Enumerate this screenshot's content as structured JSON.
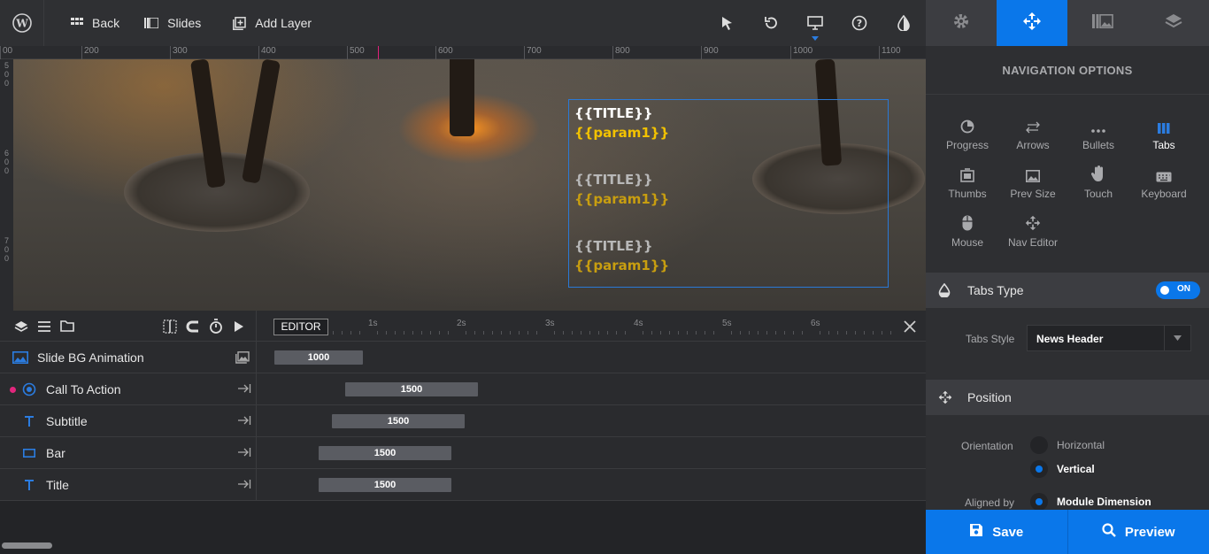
{
  "topbar": {
    "back": "Back",
    "slides": "Slides",
    "add_layer": "Add Layer"
  },
  "ruler": {
    "ticks": [
      "00",
      "200",
      "300",
      "400",
      "500",
      "600",
      "700",
      "800",
      "900",
      "1000",
      "1100"
    ],
    "vticks": [
      "500",
      "600",
      "700"
    ]
  },
  "canvas": {
    "items": [
      {
        "title": "{{TITLE}}",
        "param": "{{param1}}"
      },
      {
        "title": "{{TITLE}}",
        "param": "{{param1}}"
      },
      {
        "title": "{{TITLE}}",
        "param": "{{param1}}"
      }
    ]
  },
  "timeline": {
    "editor": "EDITOR",
    "seconds": [
      "1s",
      "2s",
      "3s",
      "4s",
      "5s",
      "6s"
    ],
    "rows": [
      {
        "label": "Slide BG Animation",
        "duration": "1000"
      },
      {
        "label": "Call To Action",
        "duration": "1500"
      },
      {
        "label": "Subtitle",
        "duration": "1500"
      },
      {
        "label": "Bar",
        "duration": "1500"
      },
      {
        "label": "Title",
        "duration": "1500"
      }
    ]
  },
  "panel": {
    "title": "NAVIGATION OPTIONS",
    "options": [
      "Progress",
      "Arrows",
      "Bullets",
      "Tabs",
      "Thumbs",
      "Prev Size",
      "Touch",
      "Keyboard",
      "Mouse",
      "Nav Editor"
    ],
    "active_option": "Tabs",
    "tabs_type": {
      "title": "Tabs Type",
      "toggle": "ON",
      "style_label": "Tabs Style",
      "style_value": "News Header"
    },
    "position": {
      "title": "Position",
      "orientation_label": "Orientation",
      "orientation_options": [
        "Horizontal",
        "Vertical"
      ],
      "orientation_selected": "Vertical",
      "aligned_label": "Aligned by",
      "aligned_value": "Module Dimension"
    }
  },
  "footer": {
    "save": "Save",
    "preview": "Preview"
  },
  "colors": {
    "accent": "#0a77ea",
    "marker": "#e2267d",
    "param": "#f2c200"
  }
}
